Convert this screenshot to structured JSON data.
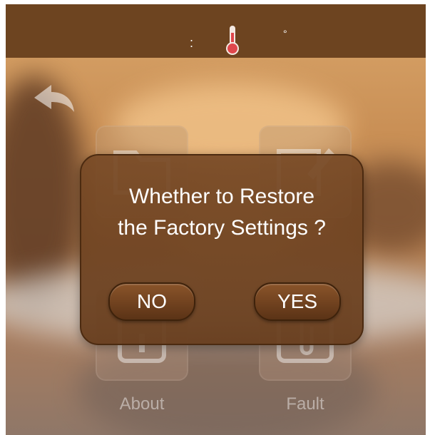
{
  "statusbar": {
    "time_separator": ":",
    "degree_symbol": "°"
  },
  "menu": {
    "tiles": [
      {
        "icon": "folder-icon"
      },
      {
        "icon": "edit-icon"
      },
      {
        "icon": "about-icon",
        "label": "About"
      },
      {
        "icon": "fault-icon",
        "label": "Fault"
      }
    ]
  },
  "dialog": {
    "line1": "Whether to Restore",
    "line2": "the Factory Settings ?",
    "no_label": "NO",
    "yes_label": "YES"
  },
  "colors": {
    "topbar": "#6d4420",
    "dialog": "#6b3f1e",
    "thermometer_fill": "#e0474c"
  }
}
